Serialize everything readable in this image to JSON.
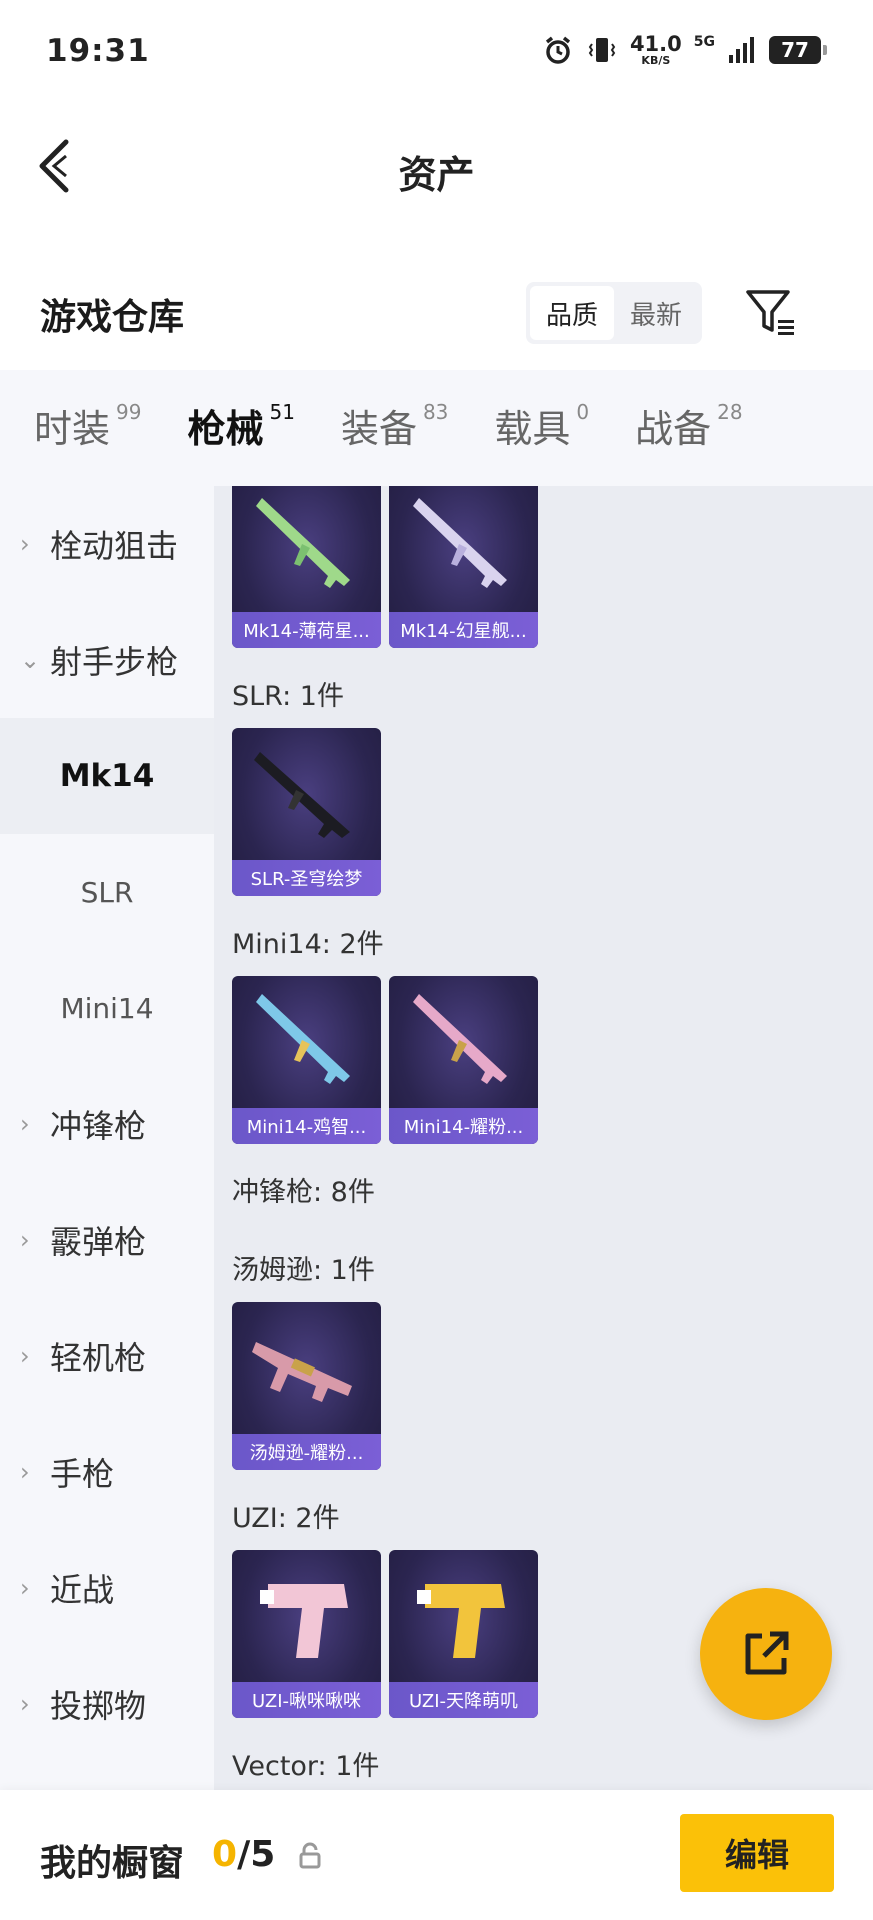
{
  "status_bar": {
    "time": "19:31",
    "net_speed_value": "41.0",
    "net_speed_unit": "KB/S",
    "network": "5G",
    "battery": "77"
  },
  "header": {
    "title": "资产",
    "back_icon": "chevron-left-icon"
  },
  "section": {
    "title": "游戏仓库",
    "sort_options": [
      "品质",
      "最新"
    ],
    "sort_selected": "品质",
    "filter_icon": "filter-icon"
  },
  "tabs": [
    {
      "label": "时装",
      "count": "99",
      "active": false
    },
    {
      "label": "枪械",
      "count": "51",
      "active": true
    },
    {
      "label": "装备",
      "count": "83",
      "active": false
    },
    {
      "label": "载具",
      "count": "0",
      "active": false
    },
    {
      "label": "战备",
      "count": "28",
      "active": false
    }
  ],
  "sidenav": [
    {
      "label": "栓动狙击",
      "type": "category",
      "expanded": false
    },
    {
      "label": "射手步枪",
      "type": "category",
      "expanded": true
    },
    {
      "label": "Mk14",
      "type": "sub",
      "active": true
    },
    {
      "label": "SLR",
      "type": "sub",
      "active": false
    },
    {
      "label": "Mini14",
      "type": "sub",
      "active": false
    },
    {
      "label": "冲锋枪",
      "type": "category",
      "expanded": false
    },
    {
      "label": "霰弹枪",
      "type": "category",
      "expanded": false
    },
    {
      "label": "轻机枪",
      "type": "category",
      "expanded": false
    },
    {
      "label": "手枪",
      "type": "category",
      "expanded": false
    },
    {
      "label": "近战",
      "type": "category",
      "expanded": false
    },
    {
      "label": "投掷物",
      "type": "category",
      "expanded": false
    }
  ],
  "content": {
    "groups": [
      {
        "label": "",
        "items": [
          "Mk14-薄荷星...",
          "Mk14-幻星舰..."
        ]
      },
      {
        "label": "SLR: 1件",
        "items": [
          "SLR-圣穹绘梦"
        ]
      },
      {
        "label": "Mini14: 2件",
        "items": [
          "Mini14-鸡智...",
          "Mini14-耀粉..."
        ]
      },
      {
        "label": "冲锋枪: 8件",
        "items": []
      },
      {
        "label": "汤姆逊: 1件",
        "items": [
          "汤姆逊-耀粉..."
        ]
      },
      {
        "label": "UZI: 2件",
        "items": [
          "UZI-啾咪啾咪",
          "UZI-天降萌叽"
        ]
      },
      {
        "label": "Vector: 1件",
        "items": []
      }
    ]
  },
  "fab": {
    "icon": "share-external-icon"
  },
  "bottom_bar": {
    "label": "我的橱窗",
    "count_current": "0",
    "count_total": "/5",
    "lock_icon": "lock-icon",
    "edit_label": "编辑"
  },
  "colors": {
    "accent": "#f5b400",
    "card_bg": "#2b2550",
    "card_label": "#6b57c9",
    "panel_bg": "#f6f7fb",
    "content_bg": "#eaecf2"
  }
}
